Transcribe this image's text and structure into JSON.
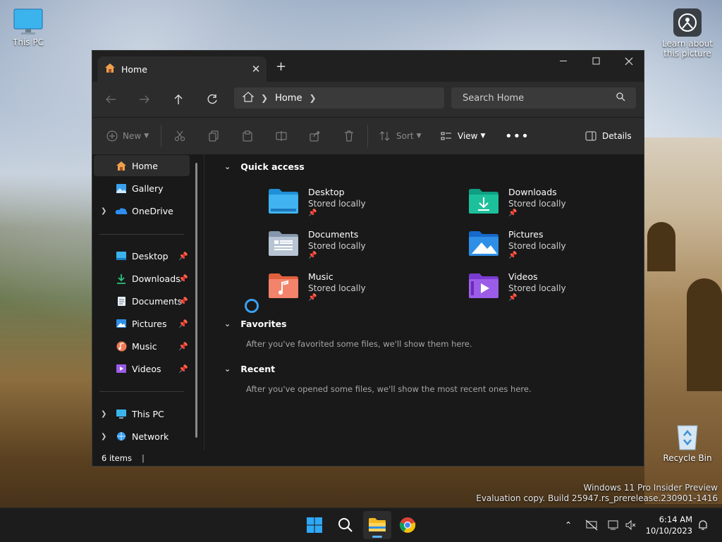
{
  "desktop": {
    "this_pc_label": "This PC",
    "learn_label_1": "Learn about",
    "learn_label_2": "this picture",
    "recycle_label": "Recycle Bin",
    "watermark_line1": "Windows 11 Pro Insider Preview",
    "watermark_line2": "Evaluation copy. Build 25947.rs_prerelease.230901-1416"
  },
  "window": {
    "tab_title": "Home",
    "address": {
      "crumb": "Home"
    },
    "search_placeholder": "Search Home",
    "commands": {
      "new": "New",
      "sort": "Sort",
      "view": "View",
      "details": "Details"
    },
    "sidebar": {
      "home": "Home",
      "gallery": "Gallery",
      "onedrive": "OneDrive",
      "desktop": "Desktop",
      "downloads": "Downloads",
      "documents": "Documents",
      "pictures": "Pictures",
      "music": "Music",
      "videos": "Videos",
      "this_pc": "This PC",
      "network": "Network"
    },
    "sections": {
      "quick_access": "Quick access",
      "favorites": "Favorites",
      "favorites_hint": "After you've favorited some files, we'll show them here.",
      "recent": "Recent",
      "recent_hint": "After you've opened some files, we'll show the most recent ones here."
    },
    "quick_access": [
      {
        "name": "Desktop",
        "status": "Stored locally"
      },
      {
        "name": "Downloads",
        "status": "Stored locally"
      },
      {
        "name": "Documents",
        "status": "Stored locally"
      },
      {
        "name": "Pictures",
        "status": "Stored locally"
      },
      {
        "name": "Music",
        "status": "Stored locally"
      },
      {
        "name": "Videos",
        "status": "Stored locally"
      }
    ],
    "status_bar": "6 items"
  },
  "taskbar": {
    "time": "6:14 AM",
    "date": "10/10/2023"
  },
  "colors": {
    "accent": "#3aa0f0",
    "window_bg": "#191919",
    "toolbar_bg": "#2c2c2c",
    "taskbar_bg": "#1c1c1c"
  },
  "icons": {
    "tab": "home-icon",
    "sidebar": [
      "home-icon",
      "gallery-icon",
      "onedrive-icon",
      "desktop-folder-icon",
      "downloads-icon",
      "documents-icon",
      "pictures-icon",
      "music-icon",
      "videos-icon",
      "this-pc-icon",
      "network-icon"
    ],
    "taskbar": [
      "windows-start-icon",
      "search-icon",
      "file-explorer-icon",
      "chrome-icon"
    ]
  }
}
